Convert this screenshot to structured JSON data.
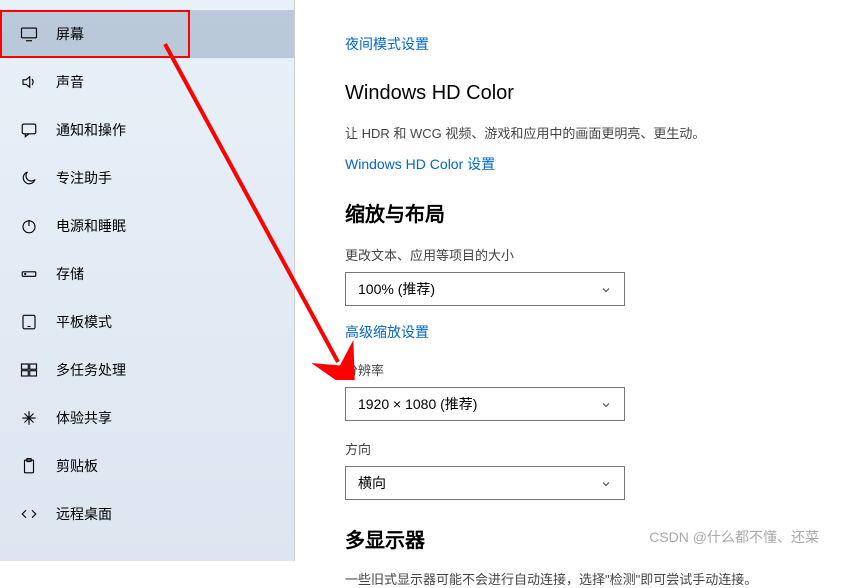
{
  "sidebar": {
    "items": [
      {
        "label": "屏幕"
      },
      {
        "label": "声音"
      },
      {
        "label": "通知和操作"
      },
      {
        "label": "专注助手"
      },
      {
        "label": "电源和睡眠"
      },
      {
        "label": "存储"
      },
      {
        "label": "平板模式"
      },
      {
        "label": "多任务处理"
      },
      {
        "label": "体验共享"
      },
      {
        "label": "剪贴板"
      },
      {
        "label": "远程桌面"
      }
    ]
  },
  "main": {
    "night_mode_link": "夜间模式设置",
    "hd_title": "Windows HD Color",
    "hd_desc": "让 HDR 和 WCG 视频、游戏和应用中的画面更明亮、更生动。",
    "hd_link": "Windows HD Color 设置",
    "scale_section": "缩放与布局",
    "scale_label": "更改文本、应用等项目的大小",
    "scale_value": "100% (推荐)",
    "adv_scale_link": "高级缩放设置",
    "resolution_label": "分辨率",
    "resolution_value": "1920 × 1080 (推荐)",
    "orientation_label": "方向",
    "orientation_value": "横向",
    "multi_title": "多显示器",
    "multi_desc": "一些旧式显示器可能不会进行自动连接，选择\"检测\"即可尝试手动连接。"
  },
  "watermark": "CSDN @什么都不懂、还菜"
}
